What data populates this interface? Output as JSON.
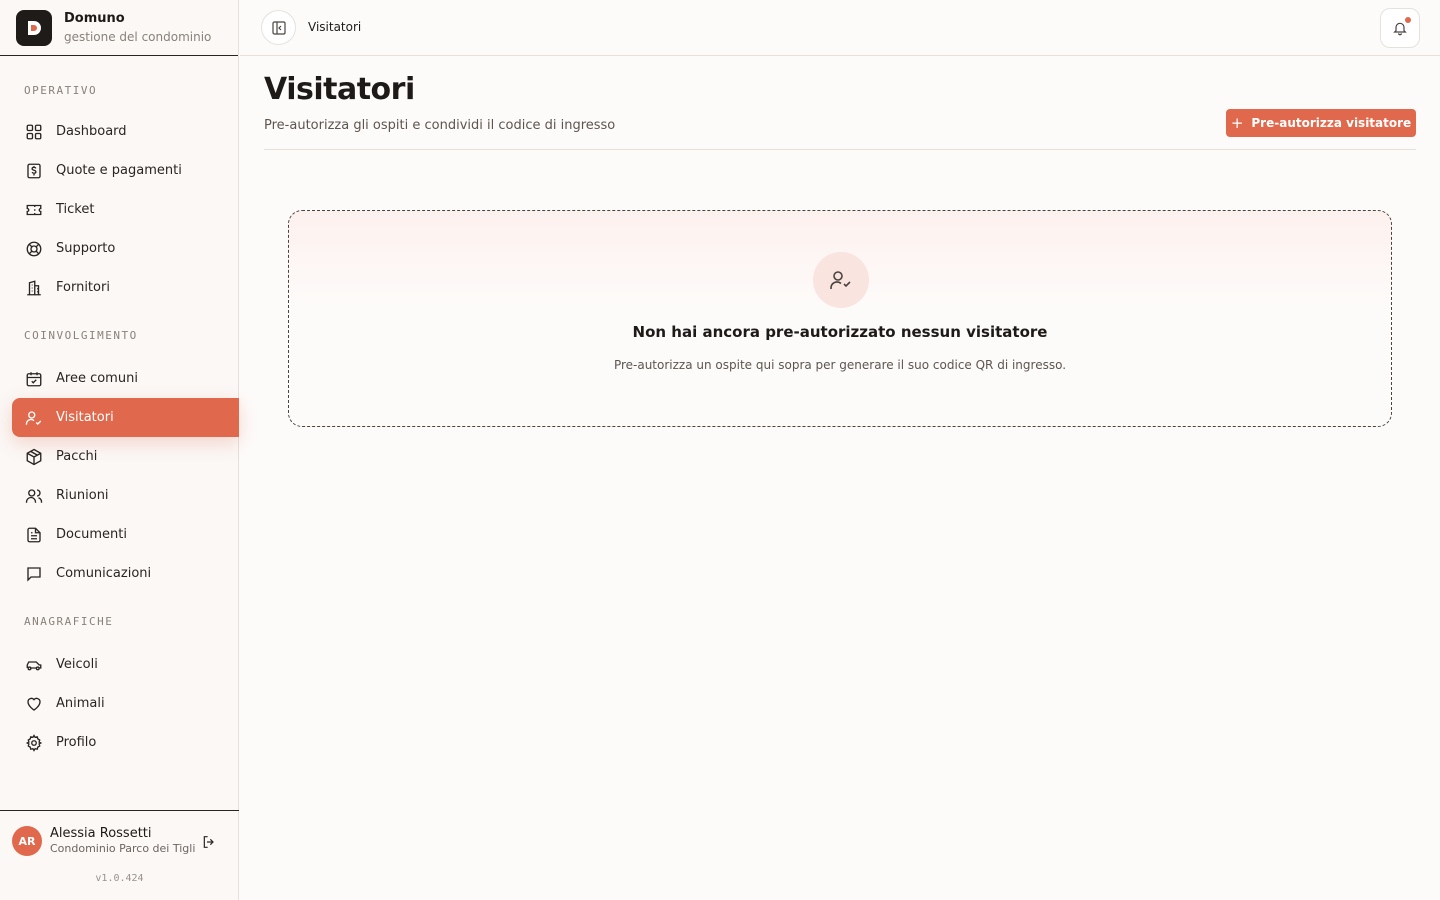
{
  "brand": {
    "name": "Domuno",
    "subtitle": "gestione del condominio"
  },
  "sidebar": {
    "sections": [
      {
        "title": "OPERATIVO",
        "items": [
          {
            "label": "Dashboard",
            "icon": "grid-icon"
          },
          {
            "label": "Quote e pagamenti",
            "icon": "dollar-receipt-icon"
          },
          {
            "label": "Ticket",
            "icon": "ticket-icon"
          },
          {
            "label": "Supporto",
            "icon": "lifebuoy-icon"
          },
          {
            "label": "Fornitori",
            "icon": "building-icon"
          }
        ]
      },
      {
        "title": "COINVOLGIMENTO",
        "items": [
          {
            "label": "Aree comuni",
            "icon": "calendar-icon"
          },
          {
            "label": "Visitatori",
            "icon": "user-check-icon",
            "active": true
          },
          {
            "label": "Pacchi",
            "icon": "package-icon"
          },
          {
            "label": "Riunioni",
            "icon": "users-icon"
          },
          {
            "label": "Documenti",
            "icon": "document-icon"
          },
          {
            "label": "Comunicazioni",
            "icon": "message-icon"
          }
        ]
      },
      {
        "title": "ANAGRAFICHE",
        "items": [
          {
            "label": "Veicoli",
            "icon": "car-icon"
          },
          {
            "label": "Animali",
            "icon": "heart-icon"
          },
          {
            "label": "Profilo",
            "icon": "gear-icon"
          }
        ]
      }
    ]
  },
  "user": {
    "initials": "AR",
    "name": "Alessia Rossetti",
    "condominium": "Condominio Parco dei Tigli",
    "version": "v1.0.424"
  },
  "topbar": {
    "breadcrumb": "Visitatori"
  },
  "page": {
    "title": "Visitatori",
    "subtitle": "Pre-autorizza gli ospiti e condividi il codice di ingresso",
    "primary_action": "Pre-autorizza visitatore"
  },
  "empty_state": {
    "title": "Non hai ancora pre-autorizzato nessun visitatore",
    "text": "Pre-autorizza un ospite qui sopra per generare il suo codice QR di ingresso."
  },
  "colors": {
    "accent": "#e0694d",
    "background": "#fdfbfa",
    "text": "#1d1a18"
  }
}
